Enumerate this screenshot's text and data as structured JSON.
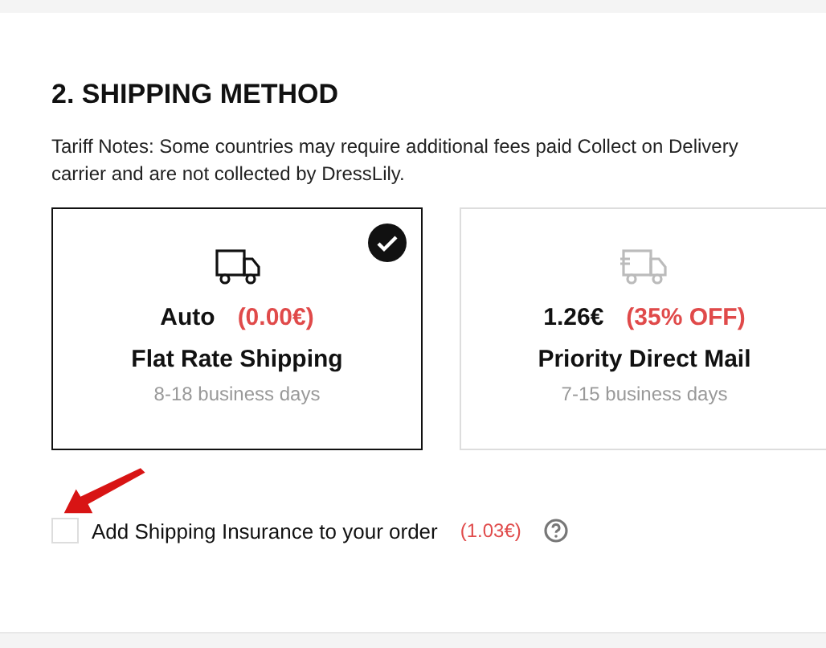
{
  "section": {
    "title": "2. SHIPPING METHOD",
    "notes": [
      "Tariff Notes: Some countries may require additional fees paid Collect on Delivery",
      "carrier and are not collected by DressLily."
    ]
  },
  "methods": [
    {
      "price": "Auto",
      "discount": "(0.00€)",
      "name": "Flat Rate Shipping",
      "days": "8-18 business days",
      "selected": true
    },
    {
      "price": "1.26€",
      "discount": "(35% OFF)",
      "name": "Priority Direct Mail",
      "days": "7-15 business days",
      "selected": false
    }
  ],
  "insurance": {
    "label": "Add Shipping Insurance to your order",
    "price": "(1.03€)",
    "checked": false
  }
}
